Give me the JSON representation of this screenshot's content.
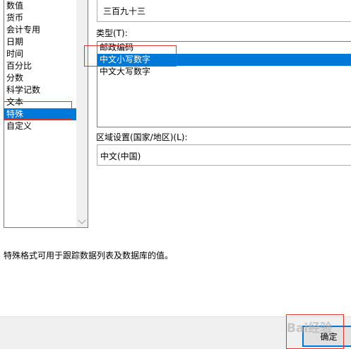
{
  "categories": [
    {
      "label": "数值",
      "selected": false
    },
    {
      "label": "货币",
      "selected": false
    },
    {
      "label": "会计专用",
      "selected": false
    },
    {
      "label": "日期",
      "selected": false
    },
    {
      "label": "时间",
      "selected": false
    },
    {
      "label": "百分比",
      "selected": false
    },
    {
      "label": "分数",
      "selected": false
    },
    {
      "label": "科学记数",
      "selected": false
    },
    {
      "label": "文本",
      "selected": false
    },
    {
      "label": "特殊",
      "selected": true
    },
    {
      "label": "自定义",
      "selected": false
    }
  ],
  "sample": {
    "value": "三百九十三"
  },
  "type": {
    "label": "类型(T):",
    "items": [
      {
        "label": "邮政编码",
        "selected": false
      },
      {
        "label": "中文小写数字",
        "selected": true
      },
      {
        "label": "中文大写数字",
        "selected": false
      }
    ]
  },
  "locale": {
    "label": "区域设置(国家/地区)(L):",
    "value": "中文(中国)"
  },
  "description": "特殊格式可用于跟踪数据列表及数据库的值。",
  "footer": {
    "ok_label": "确定"
  },
  "watermark": "Bai经验",
  "colors": {
    "selection": "#0078d7",
    "annotation": "#e0332b",
    "footer_bg": "#f0f0f0"
  }
}
